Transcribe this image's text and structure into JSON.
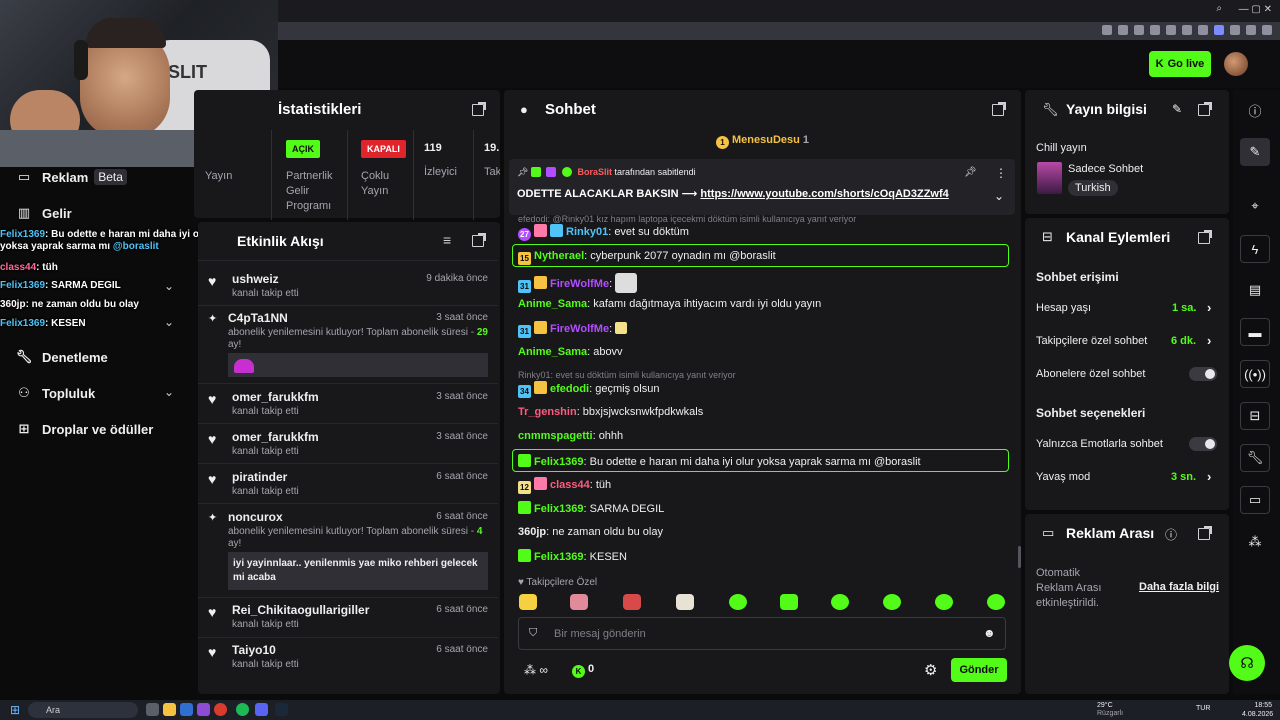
{
  "header": {
    "go_live_label": "Go live",
    "go_live_icon": "kick-logo-icon"
  },
  "webcam": {
    "chair_brand": "SLIT"
  },
  "sidebar": {
    "items": [
      {
        "label": "Reklam",
        "badge": "Beta",
        "icon": "monitor-icon"
      },
      {
        "label": "Gelir",
        "icon": "chart-icon"
      },
      {
        "label": "Denetleme",
        "icon": "wrench-icon"
      },
      {
        "label": "Topluluk",
        "icon": "people-icon"
      },
      {
        "label": "Droplar ve ödüller",
        "icon": "gift-icon"
      }
    ]
  },
  "overlay_chat": [
    {
      "user": "Felix1369",
      "msg": ": Bu odette e haran mi daha iyi olur yoksa yaprak sarma mı",
      "mention": "@boraslit"
    },
    {
      "user": "class44",
      "msg": ": tüh"
    },
    {
      "user": "Felix1369",
      "msg": ": SARMA DEGIL"
    },
    {
      "user": "360jp",
      "msg": ": ne zaman oldu bu olay"
    },
    {
      "user": "Felix1369",
      "msg": ": KESEN"
    }
  ],
  "stats": {
    "title": "İstatistikleri",
    "col1_label": "Yayın",
    "col2_tag": "AÇIK",
    "col2_label": "Partnerlik Gelir Programı",
    "col3_tag": "KAPALI",
    "col3_label": "Çoklu Yayın",
    "col4_value": "119",
    "col4_label": "İzleyici",
    "col5_value": "19.",
    "col5_label": "Tak"
  },
  "feed": {
    "title": "Etkinlik Akışı",
    "items": [
      {
        "name": "ushweiz",
        "time": "9 dakika önce",
        "sub": "kanalı takip etti"
      },
      {
        "name": "C4pTa1NN",
        "time": "3 saat önce",
        "sub": "abonelik yenilemesini kutluyor! Toplam abonelik süresi - ",
        "months": "29",
        "sub_end": "ay!"
      },
      {
        "name": "omer_farukkfm",
        "time": "3 saat önce",
        "sub": "kanalı takip etti"
      },
      {
        "name": "omer_farukkfm",
        "time": "3 saat önce",
        "sub": "kanalı takip etti"
      },
      {
        "name": "piratinder",
        "time": "6 saat önce",
        "sub": "kanalı takip etti"
      },
      {
        "name": "noncurox",
        "time": "6 saat önce",
        "sub": "abonelik yenilemesini kutluyor! Toplam abonelik süresi - ",
        "months": "4",
        "sub_end": "ay!",
        "message": "iyi yayinnlaar.. yenilenmis yae miko rehberi gelecek mi acaba"
      },
      {
        "name": "Rei_Chikitaogullarigiller",
        "time": "6 saat önce",
        "sub": "kanalı takip etti"
      },
      {
        "name": "Taiyo10",
        "time": "6 saat önce",
        "sub": "kanalı takip etti"
      }
    ]
  },
  "chat": {
    "title": "Sohbet",
    "top_gifter": "MenesuDesu",
    "top_gifter_count": "1",
    "pinned_by": "BoraSlit",
    "pinned_suffix": "tarafından sabitlendi",
    "pinned_text": "ODETTE ALACAKLAR BAKSIN ⟶",
    "pinned_link": "https://www.youtube.com/shorts/cOqAD3ZZwf4",
    "reply1": "efedodi: @Rinky01 kız hapım laptopa içecekmi döktüm isimli kullanıcıya yanıt veriyor",
    "reply2": "Rinky01: evet su döktüm isimli kullanıcıya yanıt veriyor",
    "messages": [
      {
        "badge": "27",
        "user": "Rinky01",
        "text": ": evet su döktüm"
      },
      {
        "badge": "15",
        "user": "Nytherael",
        "text": ": cyberpunk 2077 oynadın mı @boraslit"
      },
      {
        "badge": "31",
        "user": "FireWolfMe",
        "text": ":"
      },
      {
        "user": "Anime_Sama",
        "text": ": kafamı dağıtmaya ihtiyacım vardı iyi oldu yayın"
      },
      {
        "badge": "31",
        "user": "FireWolfMe",
        "text": ":"
      },
      {
        "user": "Anime_Sama",
        "text": ": abovv"
      },
      {
        "badge": "34",
        "user": "efedodi",
        "text": ": geçmiş olsun"
      },
      {
        "user": "Tr_genshin",
        "text": ": bbxjsjwcksnwkfpdkwkals"
      },
      {
        "user": "cnmmspagetti",
        "text": ": ohhh"
      },
      {
        "user": "Felix1369",
        "text": ": Bu odette e haran mi daha iyi olur yoksa yaprak sarma mı @boraslit"
      },
      {
        "badge": "12",
        "user": "class44",
        "text": ": tüh"
      },
      {
        "user": "Felix1369",
        "text": ": SARMA DEGIL"
      },
      {
        "user": "360jp",
        "text": ": ne zaman oldu bu olay"
      },
      {
        "user": "Felix1369",
        "text": ": KESEN"
      }
    ],
    "emote_section": "Takipçilere Özel",
    "input_placeholder": "Bir mesaj gönderin",
    "points": "0",
    "send_label": "Gönder"
  },
  "stream_info": {
    "title": "Yayın bilgisi",
    "stream_title": "Chill yayın",
    "category": "Sadece Sohbet",
    "language": "Turkish"
  },
  "channel_actions": {
    "title": "Kanal Eylemleri",
    "section1": "Sohbet erişimi",
    "account_age_label": "Hesap yaşı",
    "account_age_value": "1 sa.",
    "followers_only_label": "Takipçilere özel sohbet",
    "followers_only_value": "6 dk.",
    "subs_only_label": "Abonelere özel sohbet",
    "section2": "Sohbet seçenekleri",
    "emote_only_label": "Yalnızca Emotlarla sohbet",
    "slow_mode_label": "Yavaş mod",
    "slow_mode_value": "3 sn."
  },
  "ad_break": {
    "title": "Reklam Arası",
    "desc": "Otomatik Reklam Arası etkinleştirildi.",
    "link": "Daha fazla bilgi"
  },
  "taskbar": {
    "search_placeholder": "Ara",
    "weather": "29°C",
    "weather_sub": "Rüzgarlı",
    "lang": "TUR",
    "time": "18:55",
    "date": "4.08.2026"
  },
  "colors": {
    "accent": "#53fc18",
    "panel": "#18181b",
    "bg": "#0b0b0c"
  }
}
